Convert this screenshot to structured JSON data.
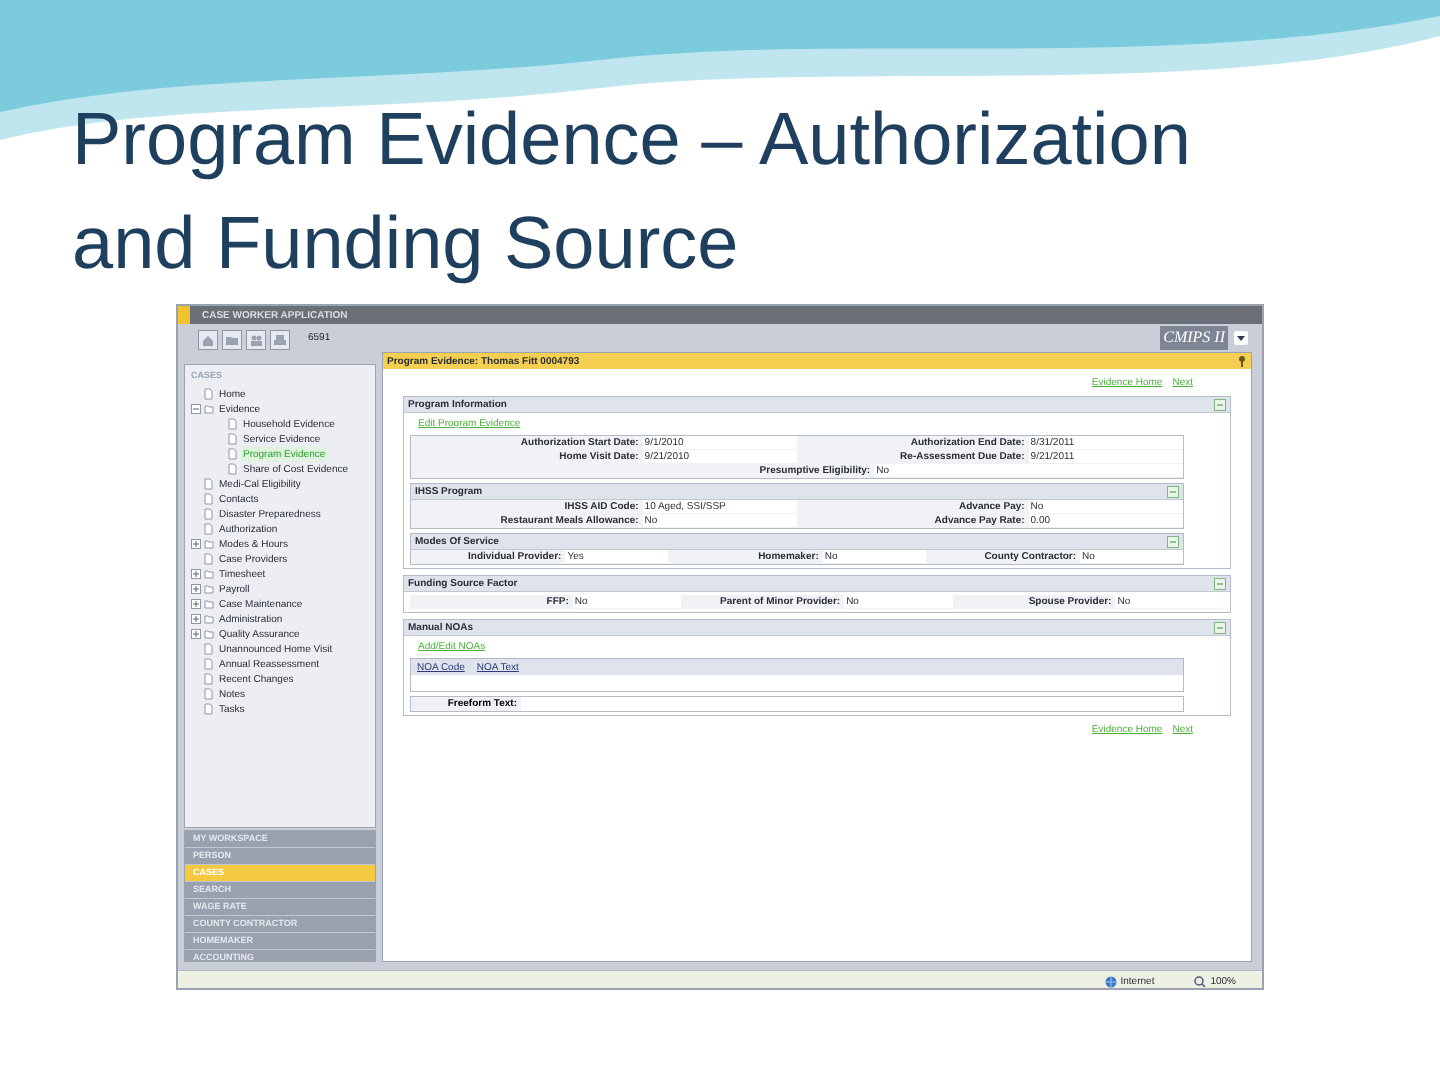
{
  "slide": {
    "title": "Program Evidence – Authorization and Funding Source"
  },
  "app": {
    "header": "CASE WORKER APPLICATION",
    "case_number": "6591",
    "brand": "CMIPS II"
  },
  "sidebar": {
    "heading": "CASES",
    "items": [
      {
        "label": "Home",
        "selected": false
      },
      {
        "label": "Evidence",
        "selected": false,
        "expanded": true,
        "children": [
          {
            "label": "Household Evidence",
            "selected": false
          },
          {
            "label": "Service Evidence",
            "selected": false
          },
          {
            "label": "Program Evidence",
            "selected": true
          },
          {
            "label": "Share of Cost Evidence",
            "selected": false
          }
        ]
      },
      {
        "label": "Medi-Cal Eligibility",
        "selected": false
      },
      {
        "label": "Contacts",
        "selected": false
      },
      {
        "label": "Disaster Preparedness",
        "selected": false
      },
      {
        "label": "Authorization",
        "selected": false
      },
      {
        "label": "Modes & Hours",
        "selected": false,
        "expanded": false
      },
      {
        "label": "Case Providers",
        "selected": false
      },
      {
        "label": "Timesheet",
        "selected": false,
        "expanded": false
      },
      {
        "label": "Payroll",
        "selected": false,
        "expanded": false
      },
      {
        "label": "Case Maintenance",
        "selected": false,
        "expanded": false
      },
      {
        "label": "Administration",
        "selected": false,
        "expanded": false
      },
      {
        "label": "Quality Assurance",
        "selected": false,
        "expanded": false
      },
      {
        "label": "Unannounced Home Visit",
        "selected": false
      },
      {
        "label": "Annual Reassessment",
        "selected": false
      },
      {
        "label": "Recent Changes",
        "selected": false
      },
      {
        "label": "Notes",
        "selected": false
      },
      {
        "label": "Tasks",
        "selected": false
      }
    ]
  },
  "nav": [
    {
      "label": "MY WORKSPACE",
      "selected": false
    },
    {
      "label": "PERSON",
      "selected": false
    },
    {
      "label": "CASES",
      "selected": true
    },
    {
      "label": "SEARCH",
      "selected": false
    },
    {
      "label": "WAGE RATE",
      "selected": false
    },
    {
      "label": "COUNTY CONTRACTOR",
      "selected": false
    },
    {
      "label": "HOMEMAKER",
      "selected": false
    },
    {
      "label": "ACCOUNTING",
      "selected": false
    }
  ],
  "page": {
    "title": "Program Evidence: Thomas Fitt 0004793",
    "top_links": [
      "Evidence Home",
      "Next"
    ],
    "sections": [
      {
        "title": "Program Information",
        "link": "Edit Program Evidence",
        "rows": [
          [
            {
              "label": "Authorization Start Date:",
              "value": "9/1/2010"
            },
            {
              "label": "Authorization End Date:",
              "value": "8/31/2011"
            }
          ],
          [
            {
              "label": "Home Visit Date:",
              "value": "9/21/2010"
            },
            {
              "label": "Re-Assessment Due Date:",
              "value": "9/21/2011"
            }
          ],
          [
            {
              "label": "Presumptive Eligibility:",
              "value": "No"
            }
          ]
        ],
        "subsections": [
          {
            "title": "IHSS Program",
            "rows": [
              [
                {
                  "label": "IHSS AID Code:",
                  "value": "10 Aged, SSI/SSP"
                },
                {
                  "label": "Advance Pay:",
                  "value": "No"
                }
              ],
              [
                {
                  "label": "Restaurant Meals Allowance:",
                  "value": "No"
                },
                {
                  "label": "Advance Pay Rate:",
                  "value": "0.00"
                }
              ]
            ]
          },
          {
            "title": "Modes Of Service",
            "rows": [
              [
                {
                  "label": "Individual Provider:",
                  "value": "Yes"
                },
                {
                  "label": "Homemaker:",
                  "value": "No"
                },
                {
                  "label": "County Contractor:",
                  "value": "No"
                }
              ]
            ]
          }
        ]
      },
      {
        "title": "Funding Source Factor",
        "rows": [
          [
            {
              "label": "FFP:",
              "value": "No"
            },
            {
              "label": "Parent of Minor Provider:",
              "value": "No"
            },
            {
              "label": "Spouse Provider:",
              "value": "No"
            }
          ]
        ]
      },
      {
        "title": "Manual NOAs",
        "link": "Add/Edit NOAs",
        "table_columns": [
          "NOA Code",
          "NOA Text"
        ],
        "freeform_label": "Freeform Text:"
      }
    ],
    "bottom_links": [
      "Evidence Home",
      "Next"
    ]
  },
  "status_bar": {
    "zone": "Internet",
    "zoom": "100%"
  }
}
